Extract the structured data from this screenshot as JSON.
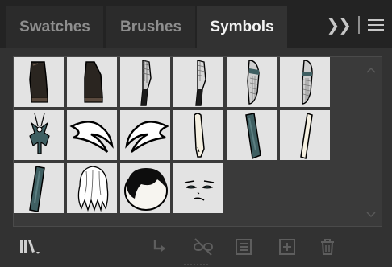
{
  "tabs": [
    {
      "label": "Swatches",
      "active": false
    },
    {
      "label": "Brushes",
      "active": false
    },
    {
      "label": "Symbols",
      "active": true
    }
  ],
  "tab_tools": {
    "expand_icon": "double-chevron-right-icon",
    "separator": "|",
    "menu_icon": "hamburger-menu-icon"
  },
  "symbols": [
    {
      "name": "dark-sleeve-1"
    },
    {
      "name": "dark-sleeve-2"
    },
    {
      "name": "sleeve-pattern-1"
    },
    {
      "name": "sleeve-pattern-2"
    },
    {
      "name": "sleeve-pattern-3"
    },
    {
      "name": "sleeve-pattern-4"
    },
    {
      "name": "bow-top"
    },
    {
      "name": "wing-left"
    },
    {
      "name": "wing-right"
    },
    {
      "name": "cream-sleeve-1"
    },
    {
      "name": "teal-sleeve-1"
    },
    {
      "name": "cream-sleeve-2"
    },
    {
      "name": "teal-sleeve-2"
    },
    {
      "name": "white-hair"
    },
    {
      "name": "head-outline"
    },
    {
      "name": "face-expression"
    }
  ],
  "footer_tools": [
    {
      "icon": "symbol-libraries-menu-icon",
      "enabled": true
    },
    {
      "icon": "place-symbol-instance-icon",
      "enabled": false
    },
    {
      "icon": "break-link-icon",
      "enabled": false
    },
    {
      "icon": "symbol-options-icon",
      "enabled": false
    },
    {
      "icon": "new-symbol-icon",
      "enabled": false
    },
    {
      "icon": "delete-symbol-icon",
      "enabled": false
    }
  ],
  "colors": {
    "tab_bar": "#232323",
    "panel_bg": "#323232",
    "swatch_bg": "#e3e3e3",
    "active_tab_text": "#f2f2f2",
    "inactive_tab_text": "#8e8e8e",
    "teal": "#3f5f62",
    "dark_cloth": "#2a2520"
  }
}
